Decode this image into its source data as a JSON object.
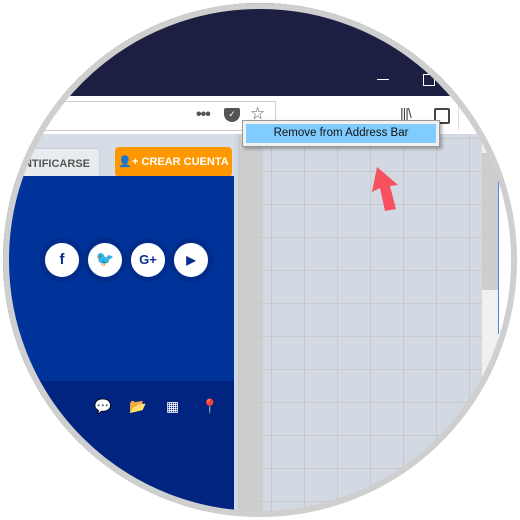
{
  "window": {
    "minimize_icon": "minimize-icon",
    "maximize_icon": "maximize-icon"
  },
  "toolbar": {
    "page_actions": "•••",
    "icons": [
      "page-actions-icon",
      "pocket-icon",
      "bookmark-star-icon",
      "library-icon",
      "sidebar-icon"
    ]
  },
  "context_menu": {
    "items": [
      {
        "label": "Remove from Address Bar"
      }
    ],
    "highlight_color": "#80ccff"
  },
  "page": {
    "login_button": "ENTIFICARSE",
    "signup_button": "CREAR CUENTA",
    "social": [
      "facebook",
      "twitter",
      "google-plus",
      "youtube"
    ],
    "footer_icons": [
      "comment",
      "folder-open",
      "calendar",
      "map-marker"
    ],
    "colors": {
      "primary": "#00339a",
      "footer": "#002480",
      "accent": "#ff9800",
      "arrow": "#f5515f"
    }
  }
}
